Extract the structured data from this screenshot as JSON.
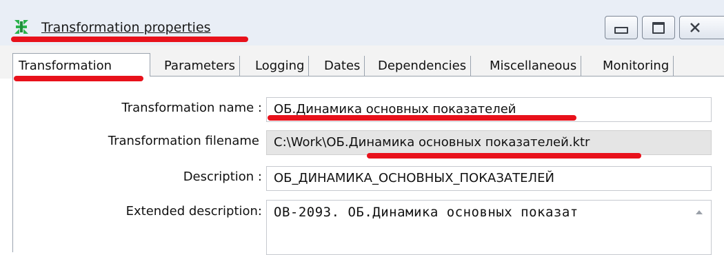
{
  "window": {
    "title": "Transformation properties",
    "icon": "transformation-icon",
    "buttons": {
      "minimize_icon": "minimize-icon",
      "maximize_icon": "maximize-icon",
      "close_icon": "close-icon"
    }
  },
  "tabs": [
    {
      "label": "Transformation",
      "active": true
    },
    {
      "label": "Parameters",
      "active": false
    },
    {
      "label": "Logging",
      "active": false
    },
    {
      "label": "Dates",
      "active": false
    },
    {
      "label": "Dependencies",
      "active": false
    },
    {
      "label": "Miscellaneous",
      "active": false
    },
    {
      "label": "Monitoring",
      "active": false
    }
  ],
  "form": {
    "name_label": "Transformation name :",
    "name_value": "ОБ.Динамика основных показателей",
    "filename_label": "Transformation filename",
    "filename_value": "C:\\Work\\ОБ.Динамика основных показателей.ktr",
    "description_label": "Description :",
    "description_value": "ОБ_ДИНАМИКА_ОСНОВНЫХ_ПОКАЗАТЕЛЕЙ",
    "extended_label": "Extended description:",
    "extended_value": "OB-2093. ОБ.Динамика основных показат"
  },
  "colors": {
    "annotation": "#e8111b",
    "icon_green": "#2bb24c",
    "titlebar": "#e9eef6"
  }
}
